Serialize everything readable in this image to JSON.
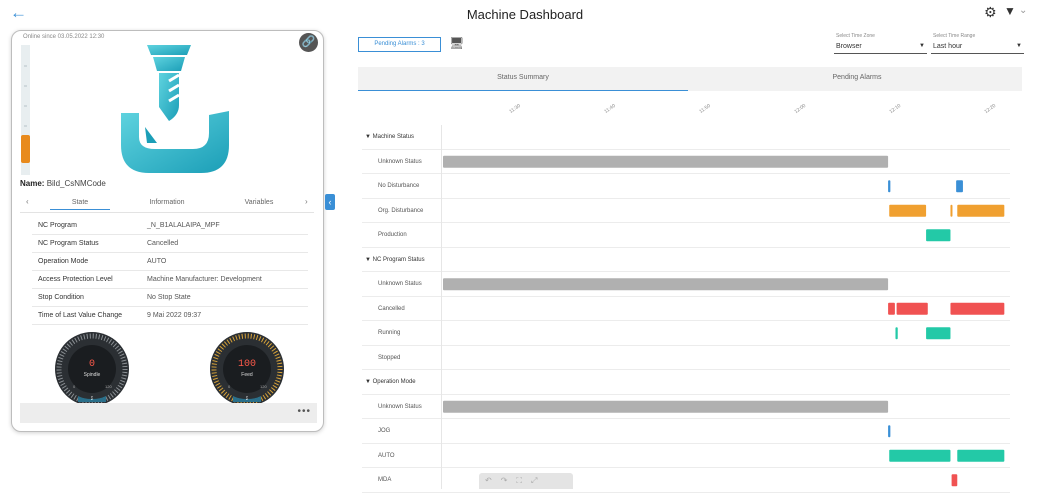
{
  "header": {
    "title": "Machine Dashboard",
    "back_icon": "arrow-left-icon"
  },
  "card": {
    "online_since": "Online since 03.05.2022 12:30",
    "name_label": "Name:",
    "name_value": "Bild_CsNMCode",
    "tabs": [
      "State",
      "Information",
      "Variables"
    ],
    "rows": [
      {
        "k": "NC Program",
        "v": "_N_B1ALALAIPA_MPF"
      },
      {
        "k": "NC Program Status",
        "v": "Cancelled"
      },
      {
        "k": "Operation Mode",
        "v": "AUTO"
      },
      {
        "k": "Access Protection Level",
        "v": "Machine Manufacturer: Development"
      },
      {
        "k": "Stop Condition",
        "v": "No Stop State"
      },
      {
        "k": "Time of Last Value Change",
        "v": "9 Mai 2022 09:37"
      }
    ],
    "gauges": [
      {
        "label": "Spindle",
        "value": "0",
        "min": "0",
        "max": "120",
        "btm": "Σ",
        "color": "#ff5a4a"
      },
      {
        "label": "Feed",
        "value": "100",
        "min": "0",
        "max": "120",
        "btm": "Σ",
        "color": "#ff5a4a"
      }
    ],
    "more": "•••"
  },
  "controls": {
    "pending_button": "Pending Alarms : 3",
    "time_zone_label": "Select Time Zone",
    "time_zone_value": "Browser",
    "time_range_label": "Select Time Range",
    "time_range_value": "Last hour"
  },
  "subtabs": [
    "Status Summary",
    "Pending Alarms"
  ],
  "time_ticks": [
    "11:30",
    "11:40",
    "11:50",
    "12:00",
    "12:10",
    "12:20"
  ],
  "timeline": {
    "colors": {
      "grey": "#b0b0b0",
      "blue": "#3a8fd6",
      "orange": "#f0a030",
      "teal": "#23c9a7",
      "red": "#f05252"
    },
    "rows": [
      {
        "type": "group",
        "label": "▼ Machine Status"
      },
      {
        "type": "item",
        "label": "Unknown Status",
        "bars": [
          {
            "s": 0.0,
            "e": 0.785,
            "c": "grey"
          }
        ]
      },
      {
        "type": "item",
        "label": "No Disturbance",
        "bars": [
          {
            "s": 0.785,
            "e": 0.789,
            "c": "blue"
          },
          {
            "s": 0.905,
            "e": 0.917,
            "c": "blue"
          }
        ]
      },
      {
        "type": "item",
        "label": "Org. Disturbance",
        "bars": [
          {
            "s": 0.787,
            "e": 0.852,
            "c": "orange"
          },
          {
            "s": 0.895,
            "e": 0.898,
            "c": "orange"
          },
          {
            "s": 0.907,
            "e": 0.99,
            "c": "orange"
          }
        ]
      },
      {
        "type": "item",
        "label": "Production",
        "bars": [
          {
            "s": 0.852,
            "e": 0.895,
            "c": "teal"
          }
        ]
      },
      {
        "type": "group",
        "label": "▼ NC Program Status"
      },
      {
        "type": "item",
        "label": "Unknown Status",
        "bars": [
          {
            "s": 0.0,
            "e": 0.785,
            "c": "grey"
          }
        ]
      },
      {
        "type": "item",
        "label": "Cancelled",
        "bars": [
          {
            "s": 0.785,
            "e": 0.797,
            "c": "red"
          },
          {
            "s": 0.8,
            "e": 0.855,
            "c": "red"
          },
          {
            "s": 0.895,
            "e": 0.99,
            "c": "red"
          }
        ]
      },
      {
        "type": "item",
        "label": "Running",
        "bars": [
          {
            "s": 0.798,
            "e": 0.802,
            "c": "teal"
          },
          {
            "s": 0.852,
            "e": 0.895,
            "c": "teal"
          }
        ]
      },
      {
        "type": "item",
        "label": "Stopped",
        "bars": []
      },
      {
        "type": "group",
        "label": "▼ Operation Mode"
      },
      {
        "type": "item",
        "label": "Unknown Status",
        "bars": [
          {
            "s": 0.0,
            "e": 0.785,
            "c": "grey"
          }
        ]
      },
      {
        "type": "item",
        "label": "JOG",
        "bars": [
          {
            "s": 0.785,
            "e": 0.789,
            "c": "blue"
          }
        ]
      },
      {
        "type": "item",
        "label": "AUTO",
        "bars": [
          {
            "s": 0.787,
            "e": 0.895,
            "c": "teal"
          },
          {
            "s": 0.907,
            "e": 0.99,
            "c": "teal"
          }
        ]
      },
      {
        "type": "item",
        "label": "MDA",
        "bars": [
          {
            "s": 0.897,
            "e": 0.907,
            "c": "red"
          }
        ]
      }
    ]
  },
  "toolbar": "↶↷⛶⤢"
}
